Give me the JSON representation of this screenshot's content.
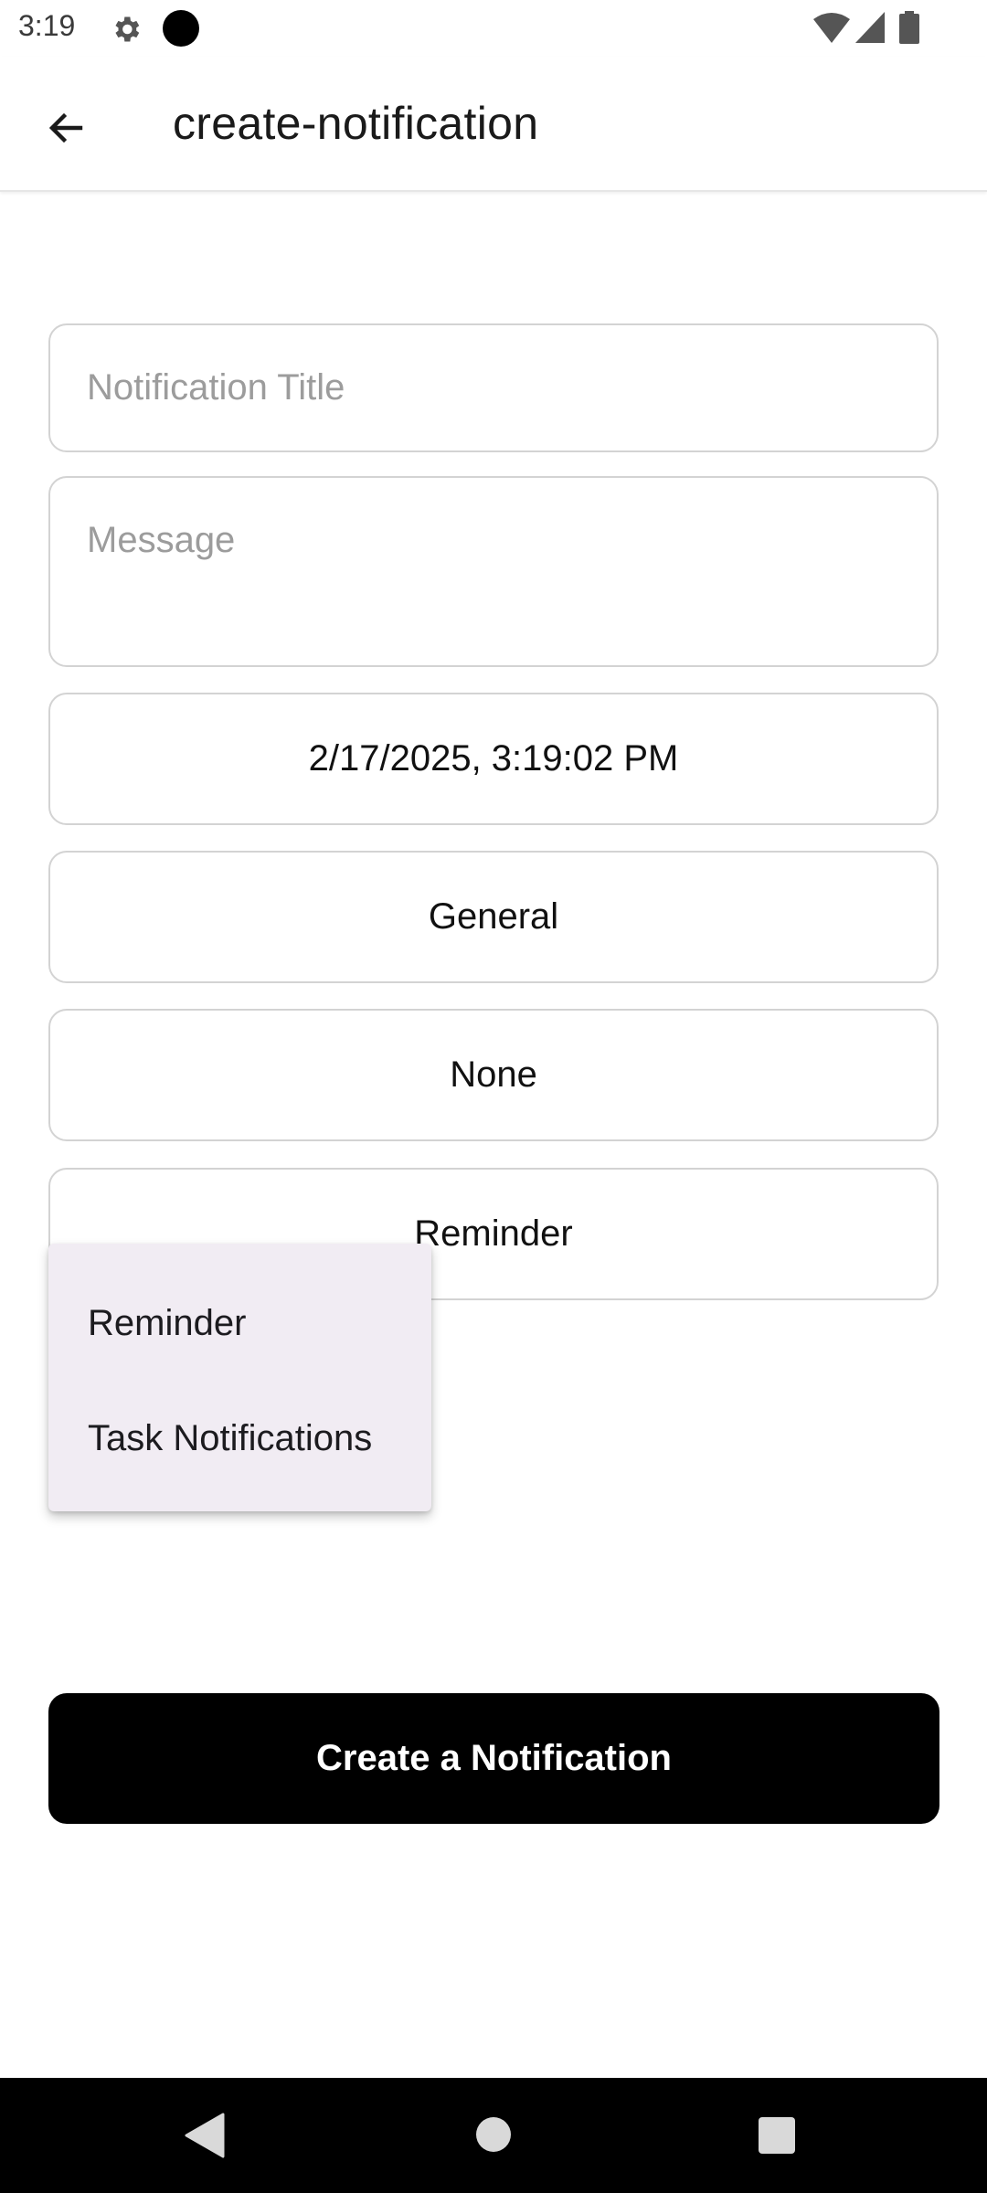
{
  "status_bar": {
    "time": "3:19",
    "icons": [
      "settings-gear-icon",
      "camera-dot-icon",
      "wifi-icon",
      "signal-icon",
      "battery-icon"
    ]
  },
  "app_bar": {
    "title": "create-notification",
    "back_icon": "arrow-left-icon"
  },
  "form": {
    "title_placeholder": "Notification Title",
    "title_value": "",
    "message_placeholder": "Message",
    "message_value": "",
    "datetime": "2/17/2025, 3:19:02 PM",
    "category": "General",
    "repeat": "None",
    "type": "Reminder"
  },
  "dropdown": {
    "options": [
      "Reminder",
      "Task Notifications"
    ]
  },
  "actions": {
    "create_label": "Create a Notification"
  },
  "colors": {
    "primary_button": "#000000",
    "menu_background": "#f1ecf3",
    "field_border": "#d3d3d3",
    "placeholder": "#9c9c9c"
  },
  "nav_bar": {
    "icons": [
      "nav-back-icon",
      "nav-home-icon",
      "nav-recents-icon"
    ]
  }
}
